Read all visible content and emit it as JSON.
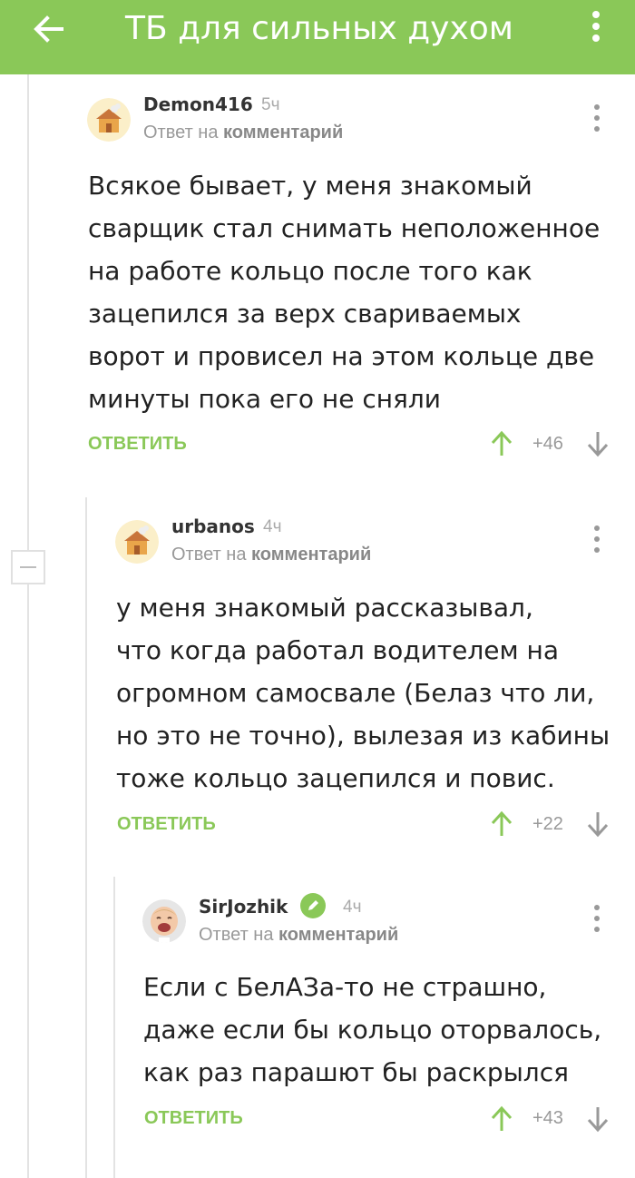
{
  "header": {
    "title": "ТБ для сильных духом",
    "back_icon": "arrow-left-icon",
    "menu_icon": "more-vertical-icon",
    "color": "#8ac858"
  },
  "comments": [
    {
      "author": "Demon416",
      "time": "5ч",
      "reply_prefix": "Ответ на",
      "reply_target": "комментарий",
      "lines": [
        "Всякое бывает, у меня знакомый",
        "сварщик стал снимать неположенное",
        "на работе кольцо после того как",
        "зацепился за верх свариваемых",
        "ворот и провисел на этом кольце две",
        "минуты пока его не сняли"
      ],
      "reply_label": "ОТВЕТИТЬ",
      "rating": "+46"
    },
    {
      "author": "urbanos",
      "time": "4ч",
      "reply_prefix": "Ответ на",
      "reply_target": "комментарий",
      "lines": [
        "у меня знакомый рассказывал,",
        "что когда работал водителем на",
        "огромном самосвале (Белаз что ли,",
        "но это не точно), вылезая из кабины",
        "тоже кольцо зацепился и повис."
      ],
      "reply_label": "ОТВЕТИТЬ",
      "rating": "+22"
    },
    {
      "author": "SirJozhik",
      "time": "4ч",
      "reply_prefix": "Ответ на",
      "reply_target": "комментарий",
      "lines": [
        "Если с БелАЗа-то не страшно,",
        "даже если бы кольцо оторвалось,",
        "как раз парашют бы раскрылся"
      ],
      "reply_label": "ОТВЕТИТЬ",
      "rating": "+43"
    }
  ]
}
